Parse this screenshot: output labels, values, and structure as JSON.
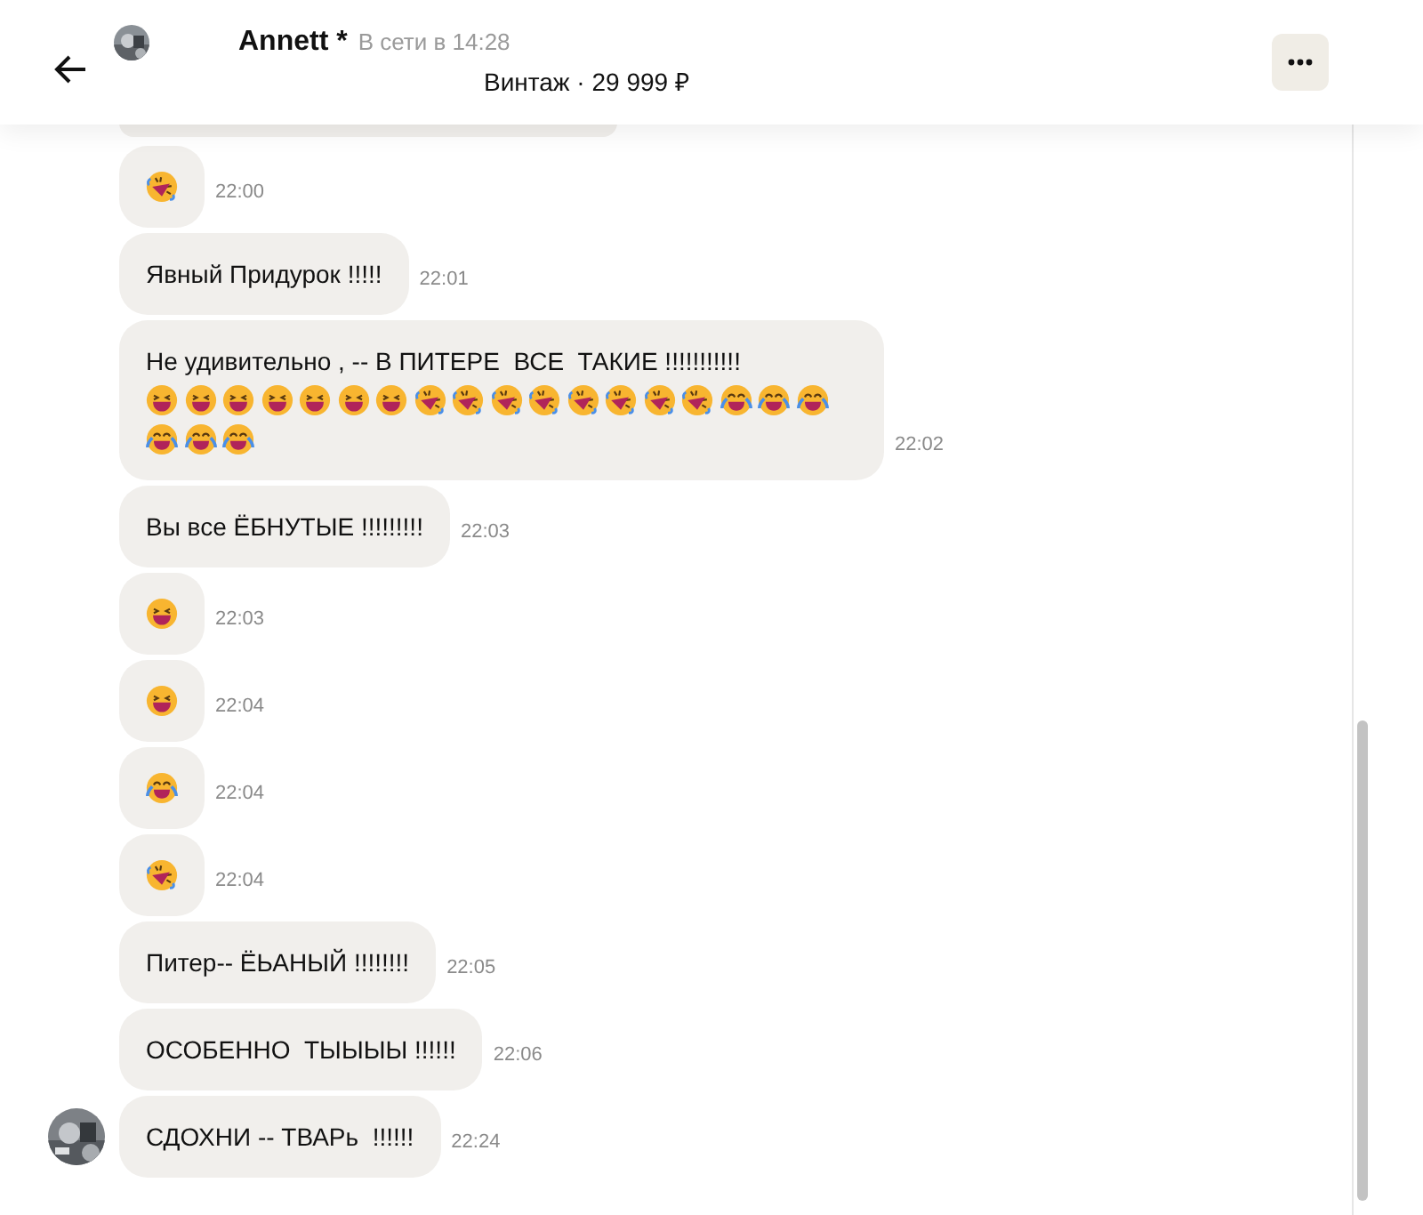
{
  "header": {
    "name": "Annett *",
    "status": "В сети в 14:28",
    "listing": "Винтаж · 29 999 ₽"
  },
  "messages": [
    {
      "time": "22:00",
      "show_avatar": false,
      "parts": [
        {
          "kind": "rofl"
        }
      ]
    },
    {
      "time": "22:01",
      "show_avatar": false,
      "parts": [
        {
          "kind": "text",
          "text": "Явный Придурок !!!!!"
        }
      ]
    },
    {
      "time": "22:02",
      "show_avatar": false,
      "parts": [
        {
          "kind": "text",
          "text": "Не удивительно , -- В ПИТЕРЕ  ВСЕ  ТАКИЕ !!!!!!!!!!!"
        },
        {
          "kind": "grin"
        },
        {
          "kind": "grin"
        },
        {
          "kind": "grin"
        },
        {
          "kind": "grin"
        },
        {
          "kind": "grin"
        },
        {
          "kind": "grin"
        },
        {
          "kind": "grin"
        },
        {
          "kind": "rofl"
        },
        {
          "kind": "rofl"
        },
        {
          "kind": "rofl"
        },
        {
          "kind": "rofl"
        },
        {
          "kind": "rofl"
        },
        {
          "kind": "rofl"
        },
        {
          "kind": "rofl"
        },
        {
          "kind": "rofl"
        },
        {
          "kind": "joy"
        },
        {
          "kind": "joy"
        },
        {
          "kind": "joy"
        },
        {
          "kind": "joy"
        },
        {
          "kind": "joy"
        },
        {
          "kind": "joy"
        }
      ]
    },
    {
      "time": "22:03",
      "show_avatar": false,
      "parts": [
        {
          "kind": "text",
          "text": "Вы все ЁБНУТЫЕ !!!!!!!!!"
        }
      ]
    },
    {
      "time": "22:03",
      "show_avatar": false,
      "parts": [
        {
          "kind": "grin"
        }
      ]
    },
    {
      "time": "22:04",
      "show_avatar": false,
      "parts": [
        {
          "kind": "grin"
        }
      ]
    },
    {
      "time": "22:04",
      "show_avatar": false,
      "parts": [
        {
          "kind": "joy"
        }
      ]
    },
    {
      "time": "22:04",
      "show_avatar": false,
      "parts": [
        {
          "kind": "rofl"
        }
      ]
    },
    {
      "time": "22:05",
      "show_avatar": false,
      "parts": [
        {
          "kind": "text",
          "text": "Питер-- ЁЬАНЫЙ !!!!!!!!"
        }
      ]
    },
    {
      "time": "22:06",
      "show_avatar": false,
      "parts": [
        {
          "kind": "text",
          "text": "ОСОБЕННО  ТЫЫЫЫ !!!!!!"
        }
      ]
    },
    {
      "time": "22:24",
      "show_avatar": true,
      "parts": [
        {
          "kind": "text",
          "text": "СДОХНИ -- ТВАРь  !!!!!!"
        }
      ]
    }
  ]
}
